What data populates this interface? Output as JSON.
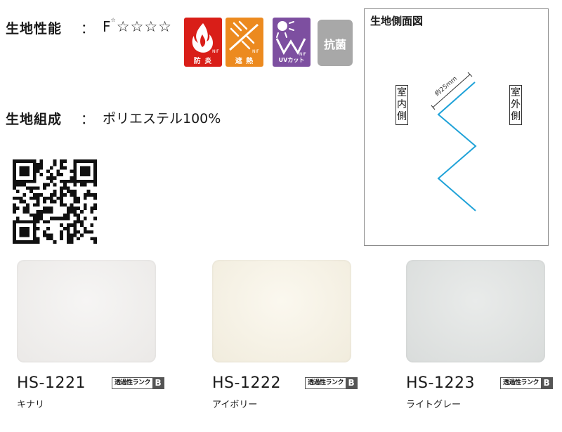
{
  "performance": {
    "label": "生地性能",
    "colon": "：",
    "formaldehyde_prefix": "F",
    "formaldehyde_sup": "☆",
    "stars": "☆☆☆☆",
    "badges": {
      "fire": "防 炎",
      "heat": "遮 熱",
      "uv": "UVカット",
      "antibacterial": "抗菌"
    }
  },
  "composition": {
    "label": "生地組成",
    "colon": "：",
    "value": "ポリエステル100%"
  },
  "diagram": {
    "title": "生地側面図",
    "indoor": "室内側",
    "outdoor": "室外側",
    "pitch": "約25mm",
    "line_color": "#1fa2d8"
  },
  "swatches": [
    {
      "code": "HS-1221",
      "name": "キナリ",
      "rank_label": "透過性ランク",
      "rank": "B"
    },
    {
      "code": "HS-1222",
      "name": "アイボリー",
      "rank_label": "透過性ランク",
      "rank": "B"
    },
    {
      "code": "HS-1223",
      "name": "ライトグレー",
      "rank_label": "透過性ランク",
      "rank": "B"
    }
  ]
}
